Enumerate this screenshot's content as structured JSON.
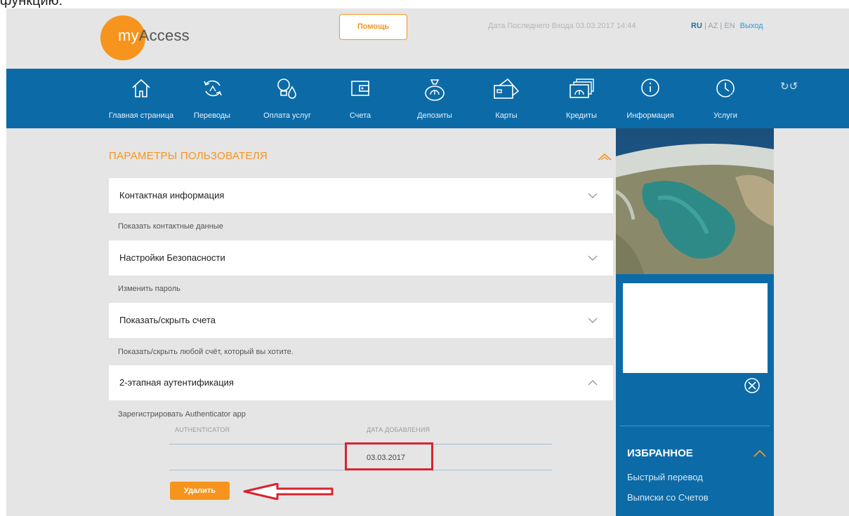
{
  "top_text": "функцию:",
  "header": {
    "logo_prefix": "my",
    "logo_suffix": "Access",
    "help_label": "Помощь",
    "last_login": "Дата Последнего Входа 03.03.2017 14:44",
    "lang_ru": "RU",
    "lang_az": "AZ",
    "lang_en": "EN",
    "lang_sep": "|",
    "logout_label": "Выход"
  },
  "nav": {
    "items": [
      {
        "label": "Главная страница",
        "icon": "home-icon"
      },
      {
        "label": "Переводы",
        "icon": "transfer-icon"
      },
      {
        "label": "Оплата услуг",
        "icon": "utilities-icon"
      },
      {
        "label": "Счета",
        "icon": "wallet-icon"
      },
      {
        "label": "Депозиты",
        "icon": "moneybag-icon"
      },
      {
        "label": "Карты",
        "icon": "cards-icon"
      },
      {
        "label": "Кредиты",
        "icon": "credit-icon"
      },
      {
        "label": "Информация",
        "icon": "info-icon"
      },
      {
        "label": "Услуги",
        "icon": "clock-icon"
      }
    ],
    "refresh_glyph": "↻↺"
  },
  "main": {
    "section_title": "ПАРАМЕТРЫ ПОЛЬЗОВАТЕЛЯ",
    "accordions": [
      {
        "title": "Контактная информация",
        "subtitle": "Показать контактные данные",
        "expanded": false
      },
      {
        "title": "Настройки Безопасности",
        "subtitle": "Изменить пароль",
        "expanded": false
      },
      {
        "title": "Показать/скрыть счета",
        "subtitle": "Показать/скрыть любой счёт, который вы хотите.",
        "expanded": false
      },
      {
        "title": "2-этапная аутентификация",
        "subtitle": "Зарегистрировать Authenticator app",
        "expanded": true
      }
    ],
    "table": {
      "col_authenticator": "AUTHENTICATOR",
      "col_date": "ДАТА ДОБАВЛЕНИЯ",
      "rows": [
        {
          "authenticator": "",
          "date": "03.03.2017"
        }
      ]
    },
    "delete_label": "Удалить"
  },
  "sidebar": {
    "favorites_title": "ИЗБРАННОЕ",
    "favorites": [
      "Быстрый перевод",
      "Выписки со Счетов"
    ]
  },
  "colors": {
    "accent_orange": "#f7941d",
    "nav_blue": "#0c6ba7",
    "highlight_red": "#d9232e"
  }
}
